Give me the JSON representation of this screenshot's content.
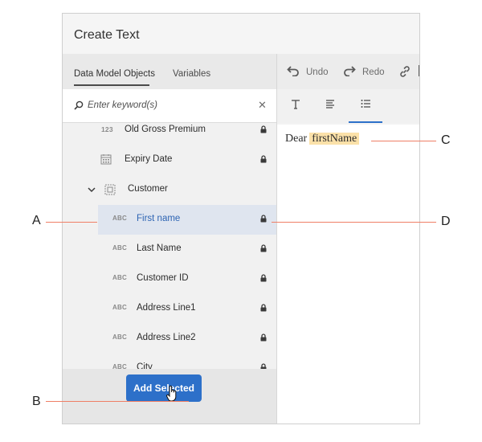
{
  "dialog": {
    "title": "Create Text"
  },
  "tabs": {
    "data_model_objects": "Data Model Objects",
    "variables": "Variables"
  },
  "search": {
    "placeholder": "Enter keyword(s)",
    "clear_icon": "✕"
  },
  "tree": {
    "items": [
      {
        "icon": "123",
        "icon_name": "number-icon",
        "label": "Old Gross Premium",
        "locked": true
      },
      {
        "icon": "calendar",
        "icon_name": "calendar-icon",
        "label": "Expiry Date",
        "locked": true
      },
      {
        "icon": "folder",
        "icon_name": "entity-icon",
        "label": "Customer",
        "expanded": true,
        "locked": false
      },
      {
        "icon": "ABC",
        "icon_name": "text-icon",
        "label": "First name",
        "locked": true,
        "selected": true
      },
      {
        "icon": "ABC",
        "icon_name": "text-icon",
        "label": "Last Name",
        "locked": true
      },
      {
        "icon": "ABC",
        "icon_name": "text-icon",
        "label": "Customer ID",
        "locked": true
      },
      {
        "icon": "ABC",
        "icon_name": "text-icon",
        "label": "Address Line1",
        "locked": true
      },
      {
        "icon": "ABC",
        "icon_name": "text-icon",
        "label": "Address Line2",
        "locked": true
      },
      {
        "icon": "ABC",
        "icon_name": "text-icon",
        "label": "City",
        "locked": true
      }
    ]
  },
  "toolbar": {
    "undo_label": "Undo",
    "redo_label": "Redo",
    "link_icon": "link-icon"
  },
  "footer": {
    "add_selected_label": "Add Selected"
  },
  "editor": {
    "text": "Dear",
    "token": "firstName"
  },
  "callouts": {
    "a": "A",
    "b": "B",
    "c": "C",
    "d": "D"
  },
  "colors": {
    "accent": "#2d70c9",
    "token_bg": "#fbe1a9",
    "callout_line": "#ef7f66",
    "selection_bg": "#dfe5ef"
  }
}
